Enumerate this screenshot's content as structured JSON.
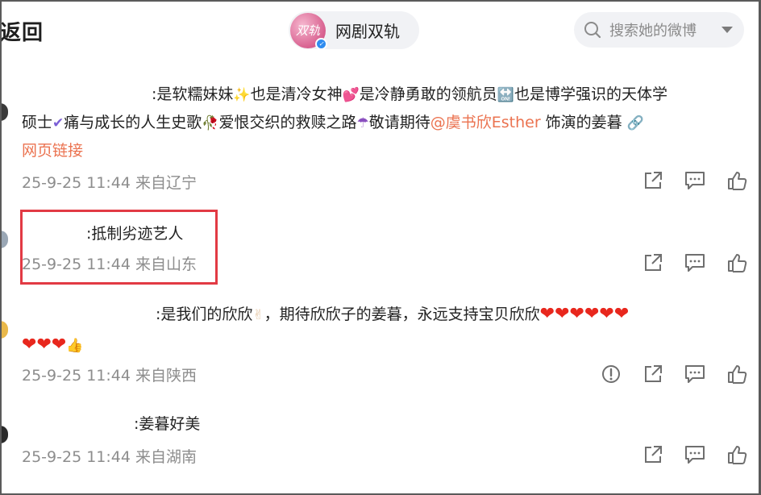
{
  "header": {
    "back_label": "返回",
    "account_name": "网剧双轨",
    "avatar_text": "双轨",
    "search_placeholder": "搜索她的微博"
  },
  "comments": [
    {
      "line1": ":是软糯妹妹",
      "line1b": "也是清冷女神",
      "line1c": "是冷静勇敢的领航员",
      "line1d": "也是博学强识的天体学",
      "line2a": "硕士",
      "line2b": "痛与成长的人生史歌",
      "line2c": "爱恨交织的救赎之路",
      "line2d": "敬请期待",
      "mention": "@虞书欣Esther",
      "line2e": " 饰演的姜暮",
      "link": "网页链接",
      "date": "25-9-25 11:44",
      "location": "来自辽宁"
    },
    {
      "text": ":抵制劣迹艺人",
      "date": "25-9-25 11:44",
      "location": "来自山东"
    },
    {
      "text": ":是我们的欣欣",
      "text_b": "，期待欣欣子的姜暮，永远支持宝贝欣欣",
      "date": "25-9-25 11:44",
      "location": "来自陕西"
    },
    {
      "text": ":姜暮好美",
      "date": "25-9-25 11:44",
      "location": "来自湖南"
    }
  ],
  "emoji_glyphs": {
    "sparkles": "✨",
    "two_hearts": "💕",
    "on_arrow": "🔛",
    "check": "✔",
    "rose": "🥀",
    "umbrella": "☂",
    "chain": "🔗",
    "victory": "✌",
    "heart": "❤",
    "thumbs_up": "👍"
  },
  "colors": {
    "accent": "#eb7350",
    "highlight_box": "#e23a44",
    "meta_text": "#8d8d8d"
  },
  "icons": [
    "search-icon",
    "chevron-down-icon",
    "share-icon",
    "comment-icon",
    "like-icon",
    "report-icon",
    "link-icon"
  ]
}
